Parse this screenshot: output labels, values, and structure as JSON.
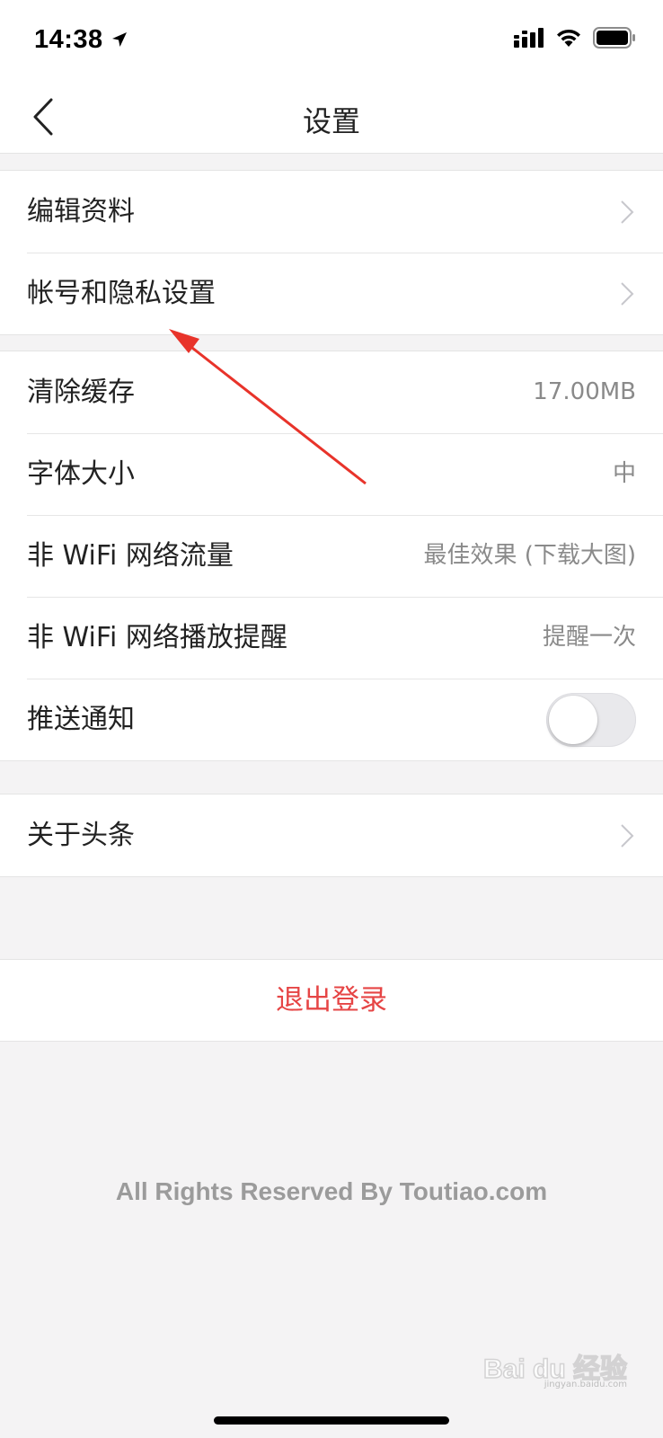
{
  "status_bar": {
    "time": "14:38"
  },
  "nav": {
    "title": "设置"
  },
  "group_profile": [
    {
      "label": "编辑资料"
    },
    {
      "label": "帐号和隐私设置"
    }
  ],
  "group_settings": {
    "clear_cache": {
      "label": "清除缓存",
      "value": "17.00MB"
    },
    "font_size": {
      "label": "字体大小",
      "value": "中"
    },
    "non_wifi_traffic": {
      "label": "非 WiFi 网络流量",
      "value": "最佳效果 (下载大图)"
    },
    "non_wifi_play_alert": {
      "label": "非 WiFi 网络播放提醒",
      "value": "提醒一次"
    },
    "push_notification": {
      "label": "推送通知",
      "enabled": false
    }
  },
  "group_about": {
    "label": "关于头条"
  },
  "logout": {
    "label": "退出登录",
    "color": "#e64545"
  },
  "footer": {
    "copyright": "All Rights Reserved By Toutiao.com"
  },
  "watermark": {
    "logo": "Bai du 经验",
    "sub": "jingyan.baidu.com"
  },
  "icons": [
    "location-arrow-icon",
    "signal-icon",
    "wifi-icon",
    "battery-icon",
    "back-chevron-icon",
    "chevron-right-icon"
  ]
}
